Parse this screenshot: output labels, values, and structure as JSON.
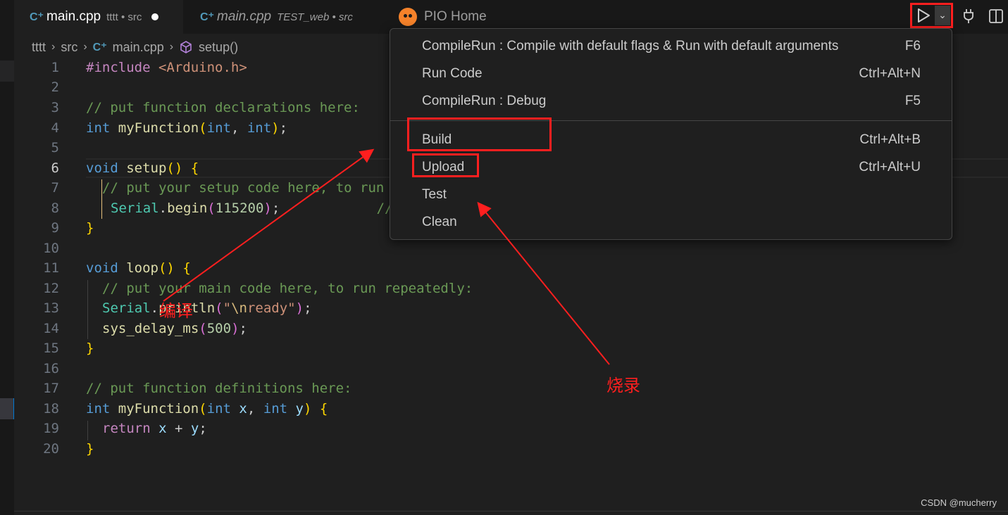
{
  "tabs": [
    {
      "name": "main.cpp",
      "desc": "tttt • src",
      "icon": "cpp-file-icon"
    },
    {
      "name": "main.cpp",
      "desc": "TEST_web • src",
      "icon": "cpp-file-icon"
    },
    {
      "name": "PIO Home",
      "icon": "platformio-ant-icon"
    }
  ],
  "icons": {
    "cpp": "C⁺",
    "play": "▷",
    "chevron": "⌄",
    "plug": "⏻",
    "split": "◫",
    "cube": "⬡"
  },
  "breadcrumb": {
    "parts": [
      "tttt",
      "src",
      "main.cpp",
      "setup()"
    ],
    "sep": "›"
  },
  "editor": {
    "line_numbers": [
      "1",
      "2",
      "3",
      "4",
      "5",
      "6",
      "7",
      "8",
      "9",
      "10",
      "11",
      "12",
      "13",
      "14",
      "15",
      "16",
      "17",
      "18",
      "19",
      "20"
    ],
    "active_line": "6"
  },
  "code_text": {
    "l1_inc": "#include",
    "l1_hdr": "<Arduino.h>",
    "l3": "// put function declarations here:",
    "int": "int",
    "void": "void",
    "return": "return",
    "myFunction": "myFunction",
    "setup": "setup",
    "loop": "loop",
    "l7": "// put your setup code here, to run",
    "serial": "Serial",
    "begin": "begin",
    "n115200": "115200",
    "l8_cm": "//",
    "l12": "// put your main code here, to run repeatedly:",
    "println": "println",
    "str_pre": "\"",
    "esc": "\\n",
    "str_post": "ready\"",
    "delay": "sys_delay_ms",
    "n500": "500",
    "l17": "// put function definitions here:",
    "x": "x",
    "y": "y"
  },
  "run_menu": {
    "items": [
      {
        "label": "CompileRun : Compile with default flags & Run with default arguments",
        "key": "F6"
      },
      {
        "label": "Run Code",
        "key": "Ctrl+Alt+N"
      },
      {
        "label": "CompileRun : Debug",
        "key": "F5"
      },
      {
        "label": "Build",
        "key": "Ctrl+Alt+B"
      },
      {
        "label": "Upload",
        "key": "Ctrl+Alt+U"
      },
      {
        "label": "Test",
        "key": ""
      },
      {
        "label": "Clean",
        "key": ""
      }
    ]
  },
  "annotations": {
    "compile": "编译",
    "burn": "烧录",
    "color": "#ff1f1f"
  },
  "watermark": "CSDN @mucherry"
}
